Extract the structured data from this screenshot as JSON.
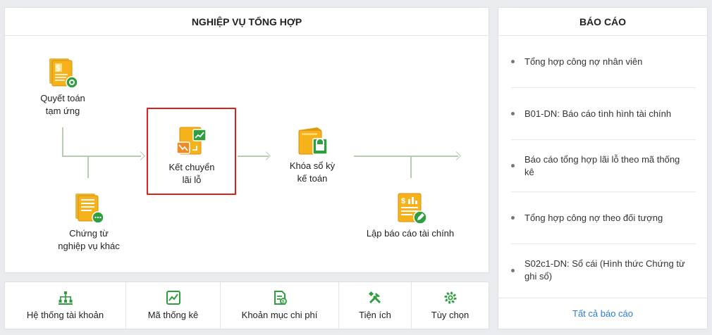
{
  "main": {
    "title": "NGHIỆP VỤ TỔNG HỢP",
    "flow": {
      "advance_settlement": "Quyết toán\ntạm ứng",
      "other_vouchers": "Chứng từ\nnghiệp vụ khác",
      "profit_loss_transfer": "Kết chuyển\nlãi lỗ",
      "lock_books": "Khóa sổ kỳ\nkế toán",
      "financial_report": "Lập báo cáo tài chính"
    }
  },
  "reports": {
    "title": "BÁO CÁO",
    "items": [
      "Tổng hợp công nợ nhân viên",
      "B01-DN: Báo cáo tình hình tài chính",
      "Báo cáo tổng hợp lãi lỗ theo mã thống kê",
      "Tổng hợp công nợ theo đối tượng",
      "S02c1-DN: Sổ cái (Hình thức Chứng từ ghi sổ)"
    ],
    "footer_link": "Tất cả báo cáo"
  },
  "tools": [
    {
      "label": "Hệ thống tài khoản",
      "icon": "account-tree-icon"
    },
    {
      "label": "Mã thống kê",
      "icon": "chart-icon"
    },
    {
      "label": "Khoản mục chi phí",
      "icon": "cost-document-icon"
    },
    {
      "label": "Tiện ích",
      "icon": "tools-icon"
    },
    {
      "label": "Tùy chọn",
      "icon": "gear-icon"
    }
  ],
  "colors": {
    "accent_green": "#2e9e3f",
    "icon_orange": "#f2a71b",
    "highlight_red": "#d9221c",
    "link_blue": "#2b7bd6"
  }
}
